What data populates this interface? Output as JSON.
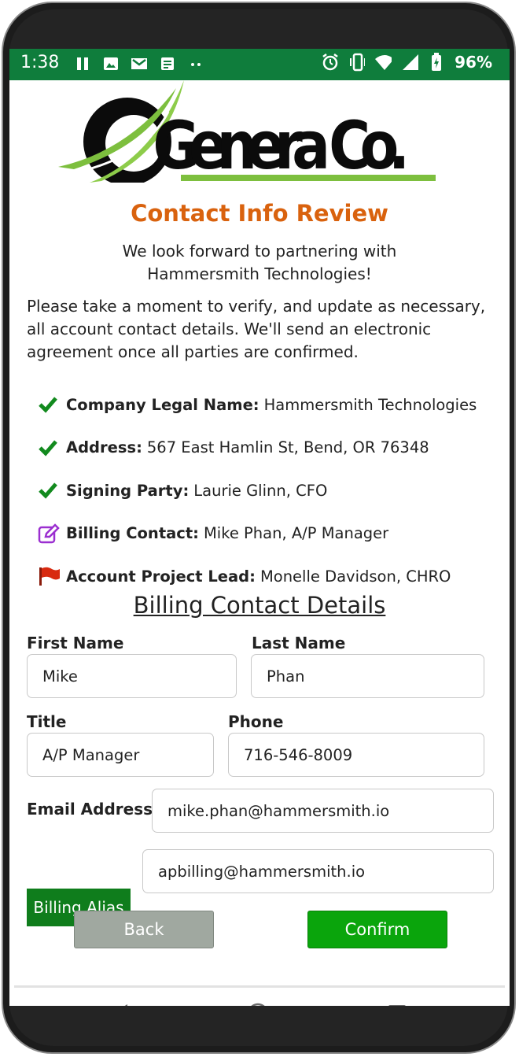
{
  "status_bar": {
    "time": "1:38",
    "battery": "96%"
  },
  "logo": {
    "text": "Genera Co."
  },
  "page": {
    "title": "Contact Info Review",
    "subtitle_line1": "We look forward to partnering with",
    "subtitle_line2": "Hammersmith Technologies!",
    "intro": "Please take a moment to verify, and update as necessary, all account contact details. We'll send an electronic agreement once all parties are confirmed."
  },
  "checklist": [
    {
      "label": "Company Legal Name:",
      "value": "Hammersmith Technologies",
      "status_icon": "check-icon"
    },
    {
      "label": "Address:",
      "value": "567 East Hamlin St, Bend, OR 76348",
      "status_icon": "check-icon"
    },
    {
      "label": "Signing Party:",
      "value": "Laurie Glinn, CFO",
      "status_icon": "check-icon"
    },
    {
      "label": "Billing Contact:",
      "value": "Mike Phan, A/P Manager",
      "status_icon": "edit-icon"
    },
    {
      "label": "Account Project Lead:",
      "value": "Monelle Davidson, CHRO",
      "status_icon": "flag-icon"
    }
  ],
  "form": {
    "section_title": "Billing Contact Details",
    "first_name_label": "First Name",
    "first_name_value": "Mike",
    "last_name_label": "Last Name",
    "last_name_value": "Phan",
    "title_label": "Title",
    "title_value": "A/P Manager",
    "phone_label": "Phone",
    "phone_value": "716-546-8009",
    "email_label": "Email Address",
    "email_value": "mike.phan@hammersmith.io",
    "alias_label": "Billing Alias",
    "alias_value": "apbilling@hammersmith.io"
  },
  "buttons": {
    "back": "Back",
    "confirm": "Confirm"
  },
  "colors": {
    "status_bar": "#0f7d3c",
    "title": "#d9620e",
    "check": "#128a1e",
    "edit": "#9b2fd0",
    "flag": "#d82a10",
    "confirm": "#0aa50c",
    "back": "#a0a8a0",
    "alias": "#0f7d1c",
    "logo_green": "#7dbf3e"
  }
}
